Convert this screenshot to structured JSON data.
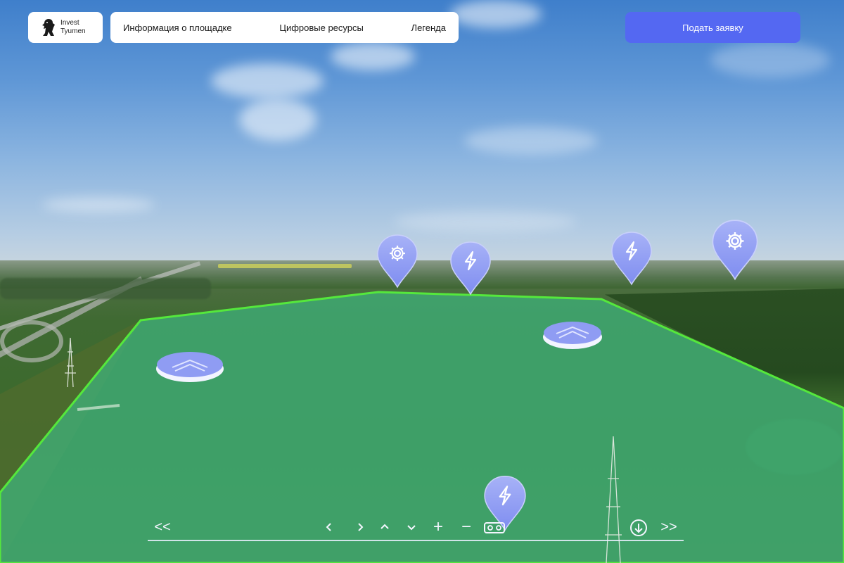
{
  "header": {
    "logo": {
      "line1": "Invest",
      "line2": "Tyumen",
      "icon": "tiger-icon"
    },
    "nav": [
      {
        "label": "Информация о площадке"
      },
      {
        "label": "Цифровые ресурсы"
      },
      {
        "label": "Легенда"
      }
    ],
    "apply_button": {
      "label": "Подать заявку"
    }
  },
  "markers": [
    {
      "type": "gear-pin",
      "icon": "gear-icon"
    },
    {
      "type": "lightning-pin",
      "icon": "lightning-icon"
    },
    {
      "type": "lightning-pin",
      "icon": "lightning-icon"
    },
    {
      "type": "gear-pin",
      "icon": "gear-icon"
    },
    {
      "type": "lightning-pin",
      "icon": "lightning-icon"
    },
    {
      "type": "move-disc",
      "icon": "chevrons-up-icon"
    },
    {
      "type": "move-disc",
      "icon": "chevrons-up-icon"
    }
  ],
  "controls": [
    {
      "name": "rewind-button",
      "glyph": "<<"
    },
    {
      "name": "pan-left-button",
      "icon": "chevron-left-icon"
    },
    {
      "name": "pan-right-button",
      "icon": "chevron-right-icon"
    },
    {
      "name": "tilt-up-button",
      "icon": "chevron-up-icon"
    },
    {
      "name": "tilt-down-button",
      "icon": "chevron-down-icon"
    },
    {
      "name": "zoom-in-button",
      "glyph": "+"
    },
    {
      "name": "zoom-out-button",
      "glyph": "−"
    },
    {
      "name": "vr-button",
      "icon": "vr-headset-icon"
    },
    {
      "name": "download-button",
      "icon": "download-icon"
    },
    {
      "name": "fast-forward-button",
      "glyph": ">>"
    }
  ],
  "colors": {
    "accent": "#5468f2",
    "marker": "#8f9cf3",
    "plot_fill": "#3fae78",
    "plot_outline": "#55e83c"
  }
}
